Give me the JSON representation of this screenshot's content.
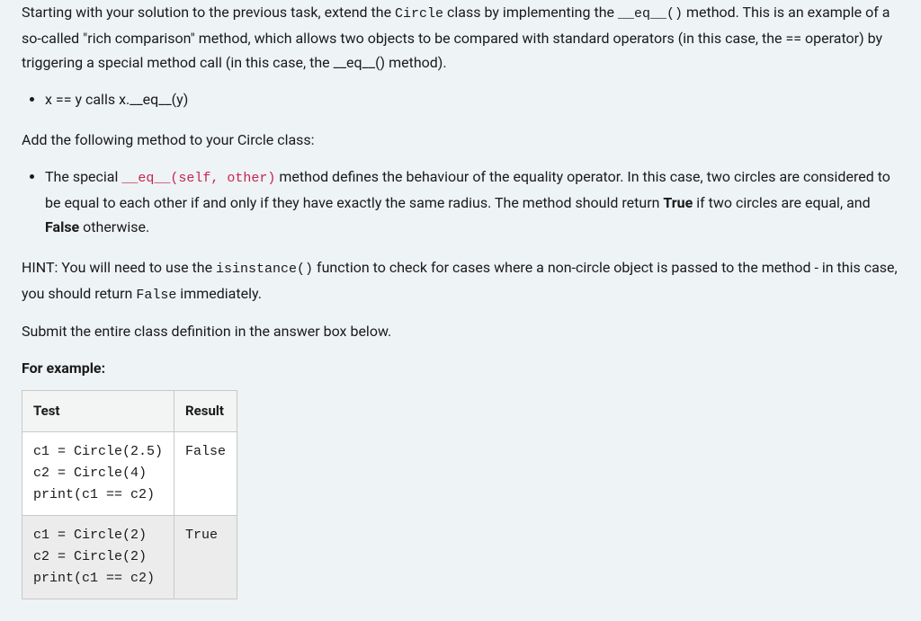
{
  "intro": {
    "p1_a": "Starting with your solution to the previous task, extend the ",
    "p1_code1": "Circle",
    "p1_b": " class by implementing the ",
    "p1_code2": "__eq__()",
    "p1_c": " method. This is an example of a so-called \"rich comparison\" method, which allows two objects to be compared with standard operators (in this case, the == operator) by triggering a special method call (in this case, the __eq__() method)."
  },
  "bullet1": "x == y calls x.__eq__(y)",
  "add_following": "Add the following method to your Circle class:",
  "bullet2": {
    "a": "The special ",
    "code": "__eq__(self, other)",
    "b": " method defines the behaviour of the equality operator. In this case, two circles are considered to be equal to each other if and only if they have exactly the same radius. The method should return ",
    "true": "True",
    "c": " if two circles are equal, and ",
    "false": "False",
    "d": " otherwise."
  },
  "hint": {
    "a": "HINT: You will need to use the ",
    "code1": "isinstance()",
    "b": " function to check for cases where a non-circle object is passed to the method - in this case, you should return ",
    "code2": "False",
    "c": " immediately."
  },
  "submit": "Submit the entire class definition in the answer box below.",
  "for_example": "For example:",
  "table": {
    "headers": {
      "test": "Test",
      "result": "Result"
    },
    "rows": [
      {
        "test": "c1 = Circle(2.5)\nc2 = Circle(4)\nprint(c1 == c2)\n",
        "result": "False"
      },
      {
        "test": "c1 = Circle(2)\nc2 = Circle(2)\nprint(c1 == c2)\n",
        "result": "True"
      }
    ]
  }
}
